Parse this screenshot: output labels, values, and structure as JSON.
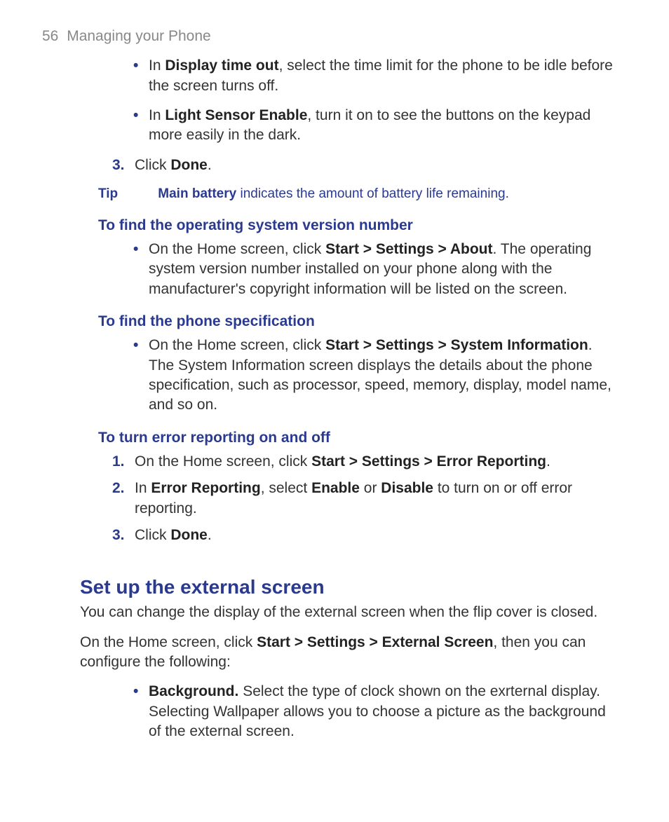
{
  "header": {
    "page_number": "56",
    "section": "Managing your Phone"
  },
  "top_bullets": [
    {
      "prefix": "In ",
      "bold": "Display time out",
      "rest": ", select the time limit for the phone to be idle before the screen turns off."
    },
    {
      "prefix": "In ",
      "bold": "Light Sensor Enable",
      "rest": ", turn it on to see the buttons on the keypad more easily in the dark."
    }
  ],
  "step3": {
    "number": "3.",
    "prefix": "Click ",
    "bold": "Done",
    "rest": "."
  },
  "tip": {
    "label": "Tip",
    "bold": "Main battery",
    "rest": " indicates the amount of battery life remaining."
  },
  "os_version": {
    "heading": "To find the operating system version number",
    "bullet": {
      "prefix": "On the Home screen, click ",
      "bold": "Start > Settings > About",
      "rest": ". The operating system version number installed on your phone along with the manufacturer's copyright information will be listed on the screen."
    }
  },
  "phone_spec": {
    "heading": "To find the phone specification",
    "bullet": {
      "prefix": "On the Home screen, click ",
      "bold": "Start > Settings > System Information",
      "rest": ". The System Information screen displays the details about the phone specification, such as processor, speed, memory, display, model name, and so on."
    }
  },
  "error_reporting": {
    "heading": "To turn error reporting on and off",
    "steps": [
      {
        "number": "1.",
        "prefix": "On the Home screen, click ",
        "bold": "Start > Settings > Error Reporting",
        "rest": "."
      },
      {
        "number": "2.",
        "prefix": "In ",
        "bold": "Error Reporting",
        "mid": ", select ",
        "bold2": "Enable",
        "mid2": " or ",
        "bold3": "Disable",
        "rest": " to turn on or off error reporting."
      },
      {
        "number": "3.",
        "prefix": "Click ",
        "bold": "Done",
        "rest": "."
      }
    ]
  },
  "external_screen": {
    "heading": "Set up the external screen",
    "intro": "You can change the display of the external screen when the flip cover is closed.",
    "path_prefix": "On the Home screen, click ",
    "path_bold": "Start > Settings > External Screen",
    "path_rest": ", then you can configure the following:",
    "bullet": {
      "bold": "Background.",
      "rest": " Select the type of clock shown on the exrternal display. Selecting Wallpaper allows you to choose a picture as the background of the external screen."
    }
  }
}
